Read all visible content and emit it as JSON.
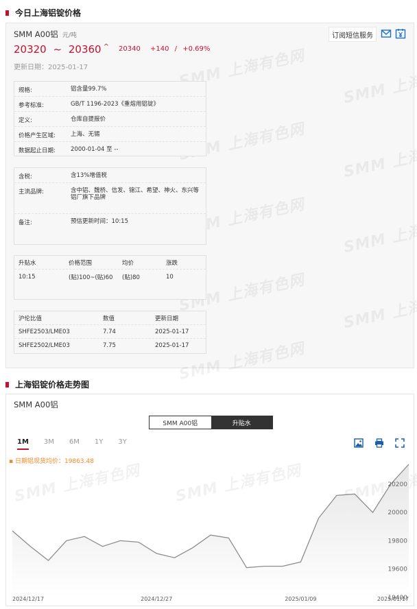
{
  "today": {
    "section_title": "今日上海铝锭价格",
    "product": "SMM A00铝",
    "unit": "元/吨",
    "price_low": "20320",
    "tilde": "~",
    "price_high": "20360",
    "caret": "^",
    "avg_price": "20340",
    "change": "+140",
    "change_sep": "/",
    "change_pct": "+0.69%",
    "update_date": "更新日期：2025-01-17",
    "subscribe_label": "订阅短信服务",
    "icons": [
      "mail-icon",
      "yen-calendar-icon"
    ],
    "accent_color": "#c8102e"
  },
  "spec_rows": [
    {
      "k": "规格:",
      "v": "铝含量99.7%"
    },
    {
      "k": "参考标准:",
      "v": "GB/T 1196-2023《重熔用铝锭》"
    },
    {
      "k": "定义:",
      "v": "仓库自提报价"
    },
    {
      "k": "价格产生区域:",
      "v": "上海、无锡"
    },
    {
      "k": "数据起止日期:",
      "v": "2000-01-04 至 --"
    }
  ],
  "tax_rows": [
    {
      "k": "含税:",
      "v": "含13%增值税"
    },
    {
      "k": "主流品牌:",
      "v": "含中铝、魏桥、信发、锦江、希望、神火、东兴等铝厂旗下品牌"
    },
    {
      "k": "备注:",
      "v": "预估更新时间：10:15"
    }
  ],
  "premium": {
    "headers": [
      "升贴水",
      "价格范围",
      "均价",
      "涨跌"
    ],
    "row": [
      "10:15",
      "(贴)100~(贴)60",
      "(贴)80",
      "10"
    ]
  },
  "ratio": {
    "headers": [
      "沪伦比值",
      "数值",
      "更新日期"
    ],
    "rows": [
      [
        "SHFE2503/LME03",
        "7.74",
        "2025-01-17"
      ],
      [
        "SHFE2502/LME03",
        "7.75",
        "2025-01-17"
      ]
    ]
  },
  "trend": {
    "section_title": "上海铝锭价格走势图",
    "product": "SMM A00铝",
    "toggle": [
      "SMM A00铝",
      "升贴水"
    ],
    "ranges": [
      "1M",
      "3M",
      "6M",
      "1Y",
      "3Y"
    ],
    "active_range": "1M",
    "legend": "日期铝现货均价：19863.48",
    "tools": [
      "image-icon",
      "print-icon",
      "fullscreen-icon"
    ]
  },
  "watermark_text": "SMM 上海有色网",
  "chart_data": {
    "type": "area",
    "x": [
      "2024-12-17",
      "2024-12-18",
      "2024-12-19",
      "2024-12-20",
      "2024-12-23",
      "2024-12-24",
      "2024-12-25",
      "2024-12-26",
      "2024-12-27",
      "2024-12-30",
      "2024-12-31",
      "2025-01-02",
      "2025-01-03",
      "2025-01-06",
      "2025-01-07",
      "2025-01-08",
      "2025-01-09",
      "2025-01-10",
      "2025-01-13",
      "2025-01-14",
      "2025-01-15",
      "2025-01-16",
      "2025-01-17"
    ],
    "series": [
      {
        "values": [
          19870,
          19760,
          19660,
          19800,
          19830,
          19760,
          19800,
          19790,
          19710,
          19680,
          19750,
          19840,
          19820,
          19610,
          19620,
          19620,
          19650,
          19960,
          20120,
          20130,
          20000,
          20200,
          20340
        ]
      }
    ],
    "x_tick_labels": [
      "2024/12/17",
      "2024/12/27",
      "2025/01/09",
      "2025/01/17"
    ],
    "x_tick_index": [
      0,
      8,
      16,
      22
    ],
    "y_ticks": [
      19400,
      19600,
      19800,
      20000,
      20200
    ],
    "ylim": [
      19400,
      20340
    ],
    "grid": false,
    "fill_color": "#e6e6e6",
    "line_color": "#8c8c8c"
  }
}
